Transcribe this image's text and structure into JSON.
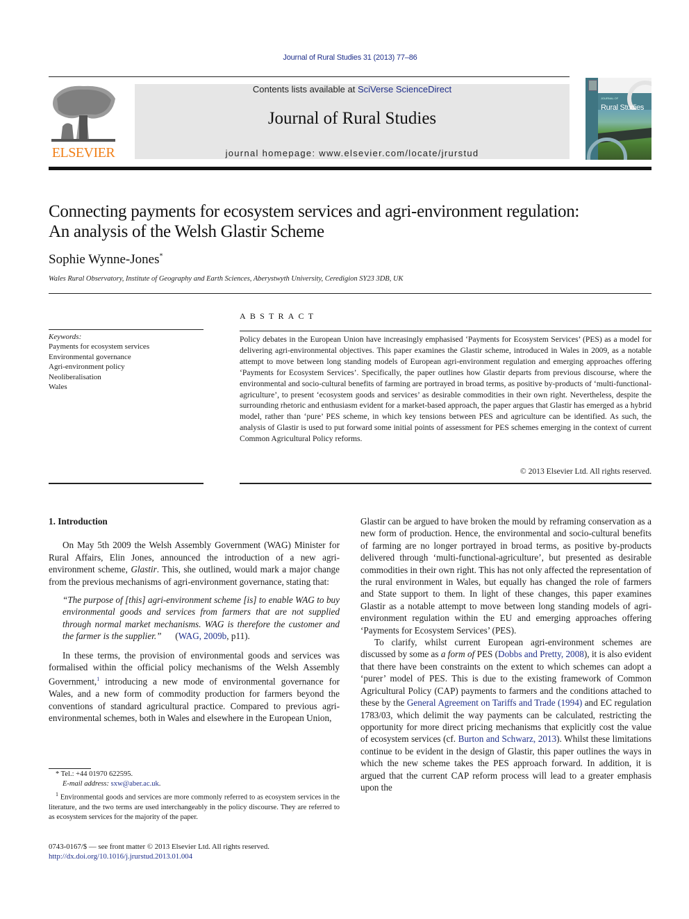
{
  "running_head": "Journal of Rural Studies 31 (2013) 77–86",
  "header": {
    "contents_prefix": "Contents lists available at ",
    "contents_link": "SciVerse ScienceDirect",
    "journal_name": "Journal of Rural Studies",
    "homepage_label": "journal homepage: www.elsevier.com/locate/jrurstud",
    "publisher_logo_text": "ELSEVIER",
    "cover_title_label": "JOURNAL OF",
    "cover_title": "Rural Studies"
  },
  "colors": {
    "link": "#1f2f8a",
    "elsevier_orange": "#f07f17",
    "header_box": "#e6e6e6"
  },
  "article": {
    "title_line1": "Connecting payments for ecosystem services and agri-environment regulation:",
    "title_line2": "An analysis of the Welsh Glastir Scheme",
    "author": "Sophie Wynne-Jones",
    "author_mark": "*",
    "affiliation": "Wales Rural Observatory, Institute of Geography and Earth Sciences, Aberystwyth University, Ceredigion SY23 3DB, UK"
  },
  "keywords": {
    "label": "Keywords:",
    "items": [
      "Payments for ecosystem services",
      "Environmental governance",
      "Agri-environment policy",
      "Neoliberalisation",
      "Wales"
    ]
  },
  "abstract": {
    "heading": "ABSTRACT",
    "text": "Policy debates in the European Union have increasingly emphasised ‘Payments for Ecosystem Services’ (PES) as a model for delivering agri-environmental objectives. This paper examines the Glastir scheme, introduced in Wales in 2009, as a notable attempt to move between long standing models of European agri-environment regulation and emerging approaches offering ‘Payments for Ecosystem Services’. Specifically, the paper outlines how Glastir departs from previous discourse, where the environmental and socio-cultural benefits of farming are portrayed in broad terms, as positive by-products of ‘multi-functional-agriculture’, to present ‘ecosystem goods and services’ as desirable commodities in their own right. Nevertheless, despite the surrounding rhetoric and enthusiasm evident for a market-based approach, the paper argues that Glastir has emerged as a hybrid model, rather than ‘pure’ PES scheme, in which key tensions between PES and agriculture can be identified. As such, the analysis of Glastir is used to put forward some initial points of assessment for PES schemes emerging in the context of current Common Agricultural Policy reforms.",
    "copyright": "© 2013 Elsevier Ltd. All rights reserved."
  },
  "body": {
    "section_heading": "1.  Introduction",
    "para1_a": "On May 5th 2009 the Welsh Assembly Government (WAG) Minister for Rural Affairs, Elin Jones, announced the introduction of a new agri-environment scheme, ",
    "para1_italic": "Glastir",
    "para1_b": ". This, she outlined, would mark a major change from the previous mechanisms of agri-environment governance, stating that:",
    "quote_text": "“The purpose of [this] agri-environment scheme [is] to enable WAG to buy environmental goods and services from farmers that are not supplied through normal market mechanisms. WAG is therefore the customer and the farmer is the supplier.”",
    "quote_cite_open": "(",
    "quote_cite_link": "WAG, 2009b",
    "quote_cite_close": ", p11).",
    "para2_a": "In these terms, the provision of environmental goods and services was formalised within the official policy mechanisms of the Welsh Assembly Government,",
    "para2_fn": "1",
    "para2_b": " introducing a new mode of environmental governance for Wales, and a new form of commodity production for farmers beyond the conventions of standard agricultural practice. Compared to previous agri-environmental schemes, both in Wales and elsewhere in the European Union,",
    "right_para1": "Glastir can be argued to have broken the mould by reframing conservation as a new form of production. Hence, the environmental and socio-cultural benefits of farming are no longer portrayed in broad terms, as positive by-products delivered through ‘multi-functional-agriculture’, but presented as desirable commodities in their own right. This has not only affected the representation of the rural environment in Wales, but equally has changed the role of farmers and State support to them. In light of these changes, this paper examines Glastir as a notable attempt to move between long standing models of agri-environment regulation within the EU and emerging approaches offering ‘Payments for Ecosystem Services’ (PES).",
    "right_para2_a": "To clarify, whilst current European agri-environment schemes are discussed by some as ",
    "right_para2_italic": "a form of",
    "right_para2_b": " PES (",
    "right_para2_link1": "Dobbs and Pretty, 2008",
    "right_para2_c": "), it is also evident that there have been constraints on the extent to which schemes can adopt a ‘purer’ model of PES. This is due to the existing framework of Common Agricultural Policy (CAP) payments to farmers and the conditions attached to these by the ",
    "right_para2_link2": "General Agreement on Tariffs and Trade (1994)",
    "right_para2_d": " and EC regulation 1783/03, which delimit the way payments can be calculated, restricting the opportunity for more direct pricing mechanisms that explicitly cost the value of ecosystem services (cf. ",
    "right_para2_link3": "Burton and Schwarz, 2013",
    "right_para2_e": "). Whilst these limitations continue to be evident in the design of Glastir, this paper outlines the ways in which the new scheme takes the PES approach forward. In addition, it is argued that the current CAP reform process will lead to a greater emphasis upon the"
  },
  "footnotes": {
    "tel": "* Tel.: +44 01970 622595.",
    "email_label": "E-mail address: ",
    "email": "sxw@aber.ac.uk",
    "email_end": ".",
    "fn1_mark": "1",
    "fn1_text": " Environmental goods and services are more commonly referred to as ecosystem services in the literature, and the two terms are used interchangeably in the policy discourse. They are referred to as ecosystem services for the majority of the paper."
  },
  "front_matter": {
    "issn": "0743-0167/$ — see front matter © 2013 Elsevier Ltd. All rights reserved.",
    "doi": "http://dx.doi.org/10.1016/j.jrurstud.2013.01.004"
  }
}
